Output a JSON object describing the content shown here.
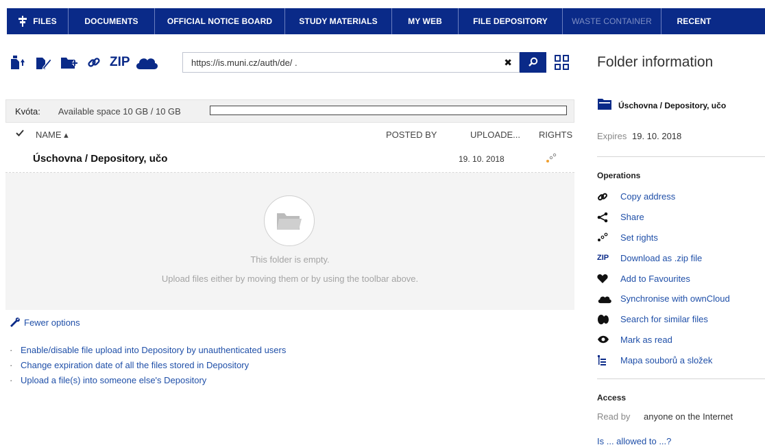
{
  "nav": [
    {
      "label": "FILES",
      "icon": "files-tree-icon",
      "disabled": false
    },
    {
      "label": "DOCUMENTS",
      "disabled": false
    },
    {
      "label": "OFFICIAL NOTICE BOARD",
      "disabled": false
    },
    {
      "label": "STUDY MATERIALS",
      "disabled": false
    },
    {
      "label": "MY WEB",
      "disabled": false
    },
    {
      "label": "FILE DEPOSITORY",
      "disabled": false
    },
    {
      "label": "WASTE CONTAINER",
      "disabled": true
    },
    {
      "label": "RECENT",
      "disabled": false
    }
  ],
  "toolbar": {
    "zip_label": "ZIP",
    "address_value": "https://is.muni.cz/auth/de/          .",
    "clear_symbol": "✖"
  },
  "quota": {
    "label": "Kvóta:",
    "value": "Available space 10 GB / 10 GB",
    "used_fraction": 0
  },
  "table": {
    "columns": [
      "NAME ▴",
      "POSTED BY",
      "UPLOADE...",
      "RIGHTS"
    ],
    "rows": [
      {
        "name": "Úschovna / Depository, učo",
        "posted_by": "",
        "uploaded": "19. 10. 2018"
      }
    ]
  },
  "empty": {
    "line1": "This folder is empty.",
    "line2": "Upload files either by moving them or by using the toolbar above."
  },
  "options": {
    "toggle_label": "Fewer options",
    "items": [
      "Enable/disable file upload into Depository by unauthenticated users",
      "Change expiration date of all the files stored in Depository",
      "Upload a file(s) into someone else's Depository"
    ]
  },
  "sidebar": {
    "title": "Folder information",
    "folder_name": "Úschovna / Depository, učo",
    "expires_label": "Expires",
    "expires_value": "19. 10. 2018",
    "operations_heading": "Operations",
    "operations": [
      {
        "label": "Copy address",
        "icon": "link-icon"
      },
      {
        "label": "Share",
        "icon": "share-icon"
      },
      {
        "label": "Set rights",
        "icon": "rights-icon"
      },
      {
        "label": "Download as .zip file",
        "icon": "zip-icon"
      },
      {
        "label": "Add to Favourites",
        "icon": "heart-icon"
      },
      {
        "label": "Synchronise with ownCloud",
        "icon": "cloud-icon"
      },
      {
        "label": "Search for similar files",
        "icon": "similar-icon"
      },
      {
        "label": "Mark as read",
        "icon": "eye-icon"
      },
      {
        "label": "Mapa souborů a složek",
        "icon": "map-icon"
      }
    ],
    "access_heading": "Access",
    "read_by_label": "Read by",
    "read_by_value": "anyone on the Internet",
    "allowed_link": "Is ... allowed to ...?"
  },
  "colors": {
    "brand": "#0a2a88",
    "link": "#1f4fa8",
    "accent_orange": "#f0a030"
  }
}
